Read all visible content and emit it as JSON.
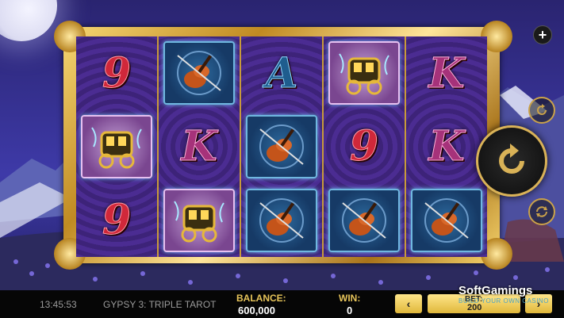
{
  "game": {
    "clock": "13:45:53",
    "title": "GYPSY 3: TRIPLE TAROT",
    "balance_label": "BALANCE:",
    "balance_value": "600,000",
    "win_label": "WIN:",
    "win_value": "0",
    "bet_label": "BET:",
    "bet_value": "200",
    "bet_prev_glyph": "‹",
    "bet_next_glyph": "›",
    "plus_glyph": "+"
  },
  "watermark": {
    "brand": "SoftGamings",
    "tagline": "BUILD YOUR OWN CASINO"
  },
  "reels": [
    [
      "9",
      "carriage",
      "9"
    ],
    [
      "violin",
      "K",
      "carriage"
    ],
    [
      "A",
      "violin",
      "violin"
    ],
    [
      "carriage",
      "9",
      "violin"
    ],
    [
      "K",
      "K",
      "violin"
    ]
  ],
  "colors": {
    "frame_gold": "#d9b257",
    "reel_bg": "#3c2480",
    "bar_bg": "#060606",
    "label_gold": "#e7c45a"
  }
}
